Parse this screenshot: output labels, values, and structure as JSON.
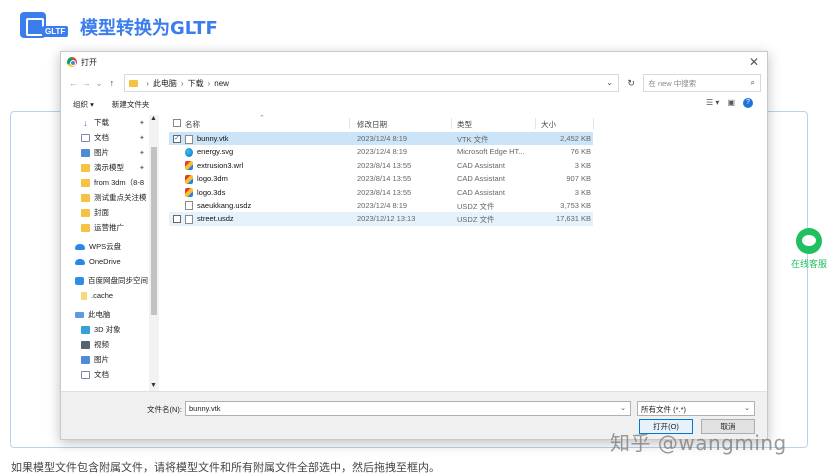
{
  "header": {
    "logo_tag": "GLTF",
    "title": "模型转换为GLTF"
  },
  "footnote": "如果模型文件包含附属文件，请将模型文件和所有附属文件全部选中，然后拖拽至框内。",
  "contact": {
    "label": "在线客服",
    "icon": "wechat-chat-icon"
  },
  "watermark": "知乎 @wangming",
  "dialog": {
    "title": "打开",
    "close": "✕",
    "path": [
      "此电脑",
      "下载",
      "new"
    ],
    "search_placeholder": "在 new 中搜索",
    "toolbar": {
      "organize": "组织 ▾",
      "new_folder": "新建文件夹"
    },
    "nav_items": [
      {
        "label": "下载",
        "icon": "download-icon",
        "pinned": true
      },
      {
        "label": "文档",
        "icon": "document-icon",
        "pinned": true
      },
      {
        "label": "图片",
        "icon": "picture-icon",
        "pinned": true
      },
      {
        "label": "演示模型",
        "icon": "folder-icon",
        "pinned": true
      },
      {
        "label": "from 3dm（8-8",
        "icon": "folder-icon",
        "pinned": false
      },
      {
        "label": "测试重点关注模",
        "icon": "folder-icon",
        "pinned": false
      },
      {
        "label": "封面",
        "icon": "folder-icon",
        "pinned": false
      },
      {
        "label": "运营推广",
        "icon": "folder-icon",
        "pinned": false
      },
      {
        "label": "WPS云盘",
        "icon": "cloud-icon",
        "pinned": false,
        "root": true
      },
      {
        "label": "OneDrive",
        "icon": "cloud-icon",
        "pinned": false,
        "root": true
      },
      {
        "label": "百度网盘同步空间",
        "icon": "baidu-drive-icon",
        "pinned": false,
        "root": true
      },
      {
        "label": ".cache",
        "icon": "folder-icon",
        "pinned": false
      },
      {
        "label": "此电脑",
        "icon": "computer-icon",
        "pinned": false,
        "root": true
      },
      {
        "label": "3D 对象",
        "icon": "3d-objects-icon",
        "pinned": false
      },
      {
        "label": "视频",
        "icon": "video-icon",
        "pinned": false
      },
      {
        "label": "图片",
        "icon": "picture-icon",
        "pinned": false
      },
      {
        "label": "文档",
        "icon": "document-icon",
        "pinned": false
      }
    ],
    "columns": {
      "name": "名称",
      "date": "修改日期",
      "type": "类型",
      "size": "大小"
    },
    "files": [
      {
        "name": "bunny.vtk",
        "date": "2023/12/4 8:19",
        "type": "VTK 文件",
        "size": "2,452 KB",
        "icon": "blank",
        "checkbox": true,
        "checked": true,
        "state": "sel"
      },
      {
        "name": "energy.svg",
        "date": "2023/12/4 8:19",
        "type": "Microsoft Edge HT...",
        "size": "76 KB",
        "icon": "edge",
        "checkbox": false,
        "checked": false,
        "state": ""
      },
      {
        "name": "extrusion3.wrl",
        "date": "2023/8/14 13:55",
        "type": "CAD Assistant",
        "size": "3 KB",
        "icon": "cad",
        "checkbox": false,
        "checked": false,
        "state": ""
      },
      {
        "name": "logo.3dm",
        "date": "2023/8/14 13:55",
        "type": "CAD Assistant",
        "size": "907 KB",
        "icon": "cad",
        "checkbox": false,
        "checked": false,
        "state": ""
      },
      {
        "name": "logo.3ds",
        "date": "2023/8/14 13:55",
        "type": "CAD Assistant",
        "size": "3 KB",
        "icon": "cad",
        "checkbox": false,
        "checked": false,
        "state": ""
      },
      {
        "name": "saeukkang.usdz",
        "date": "2023/12/4 8:19",
        "type": "USDZ 文件",
        "size": "3,753 KB",
        "icon": "blank",
        "checkbox": false,
        "checked": false,
        "state": ""
      },
      {
        "name": "street.usdz",
        "date": "2023/12/12 13:13",
        "type": "USDZ 文件",
        "size": "17,631 KB",
        "icon": "blank",
        "checkbox": true,
        "checked": false,
        "state": "hl"
      }
    ],
    "filename_label": "文件名(N):",
    "filename_value": "bunny.vtk",
    "filetype_value": "所有文件 (*.*)",
    "open_label": "打开(O)",
    "cancel_label": "取消"
  }
}
